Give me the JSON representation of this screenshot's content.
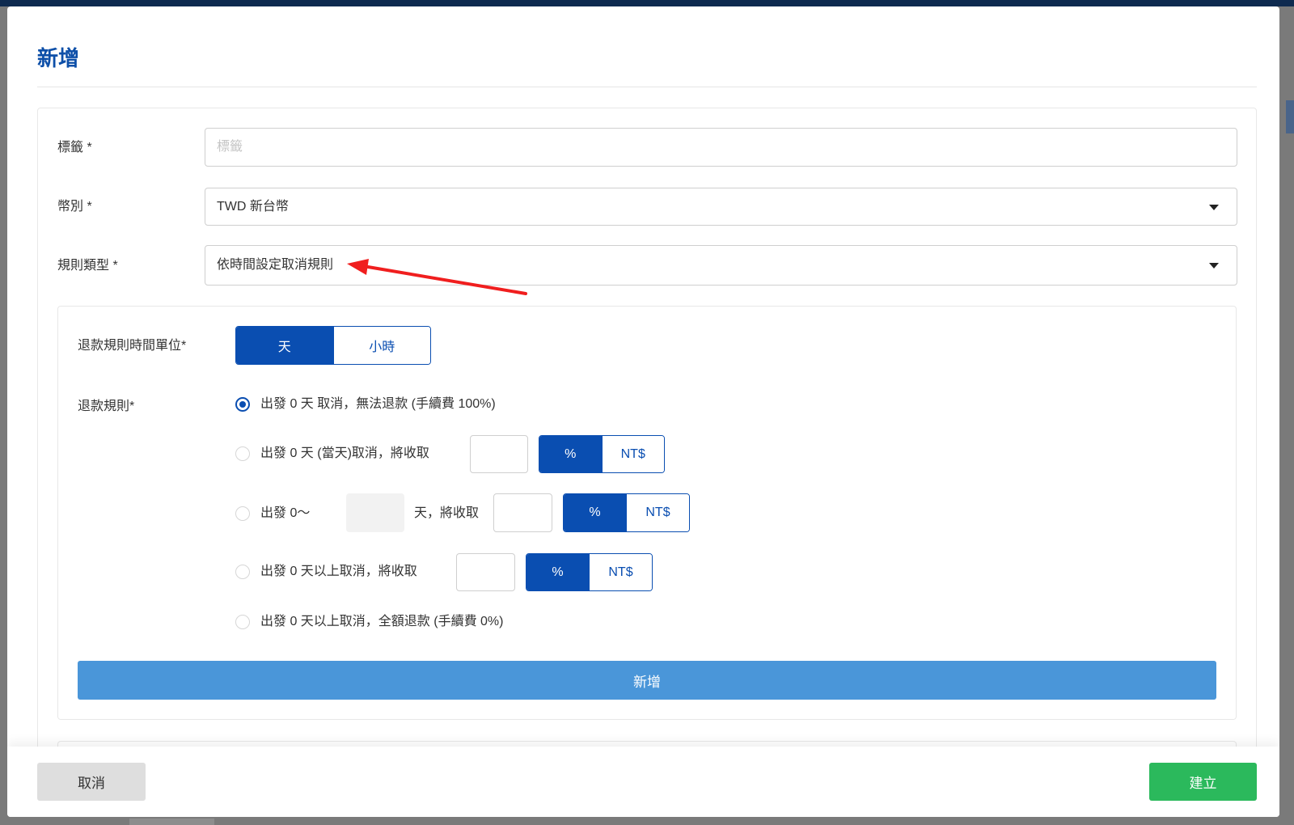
{
  "window": {
    "title": "新增"
  },
  "form": {
    "tag": {
      "label": "標籤 *",
      "placeholder": "標籤",
      "value": ""
    },
    "currency": {
      "label": "幣別 *",
      "value": "TWD 新台幣"
    },
    "rule_type": {
      "label": "規則類型 *",
      "value": "依時間設定取消規則"
    }
  },
  "refund": {
    "time_unit": {
      "label": "退款規則時間單位*",
      "options": [
        "天",
        "小時"
      ],
      "selected": "天"
    },
    "rules_label": "退款規則*",
    "rules": [
      {
        "text": "出發 0 天 取消，無法退款 (手續費 100%)",
        "checked": true
      },
      {
        "text": "出發 0 天 (當天)取消，將收取",
        "amount": "",
        "unit": "%",
        "checked": false
      },
      {
        "text_before": "出發 0～",
        "days": "",
        "text_after": "天，將收取",
        "amount": "",
        "unit": "%",
        "checked": false
      },
      {
        "text": "出發 0 天以上取消，將收取",
        "amount": "",
        "unit": "%",
        "checked": false
      },
      {
        "text": "出發 0 天以上取消，全額退款 (手續費 0%)",
        "checked": false
      }
    ],
    "unit_options": [
      "%",
      "NT$"
    ],
    "add_label": "新增"
  },
  "footer": {
    "cancel_label": "取消",
    "create_label": "建立"
  },
  "colors": {
    "primary": "#0a4eb1",
    "add": "#4a96d9",
    "create": "#2bb95c",
    "cancel": "#dedede",
    "arrow": "#f01e1e",
    "title": "#0d4fa8",
    "overlay": "#7a7a7a",
    "bar": "#0e2a4f"
  },
  "icons": {
    "select_caret": "caret-down-icon",
    "radio": "radio-icon",
    "annotation": "red-arrow-icon"
  }
}
